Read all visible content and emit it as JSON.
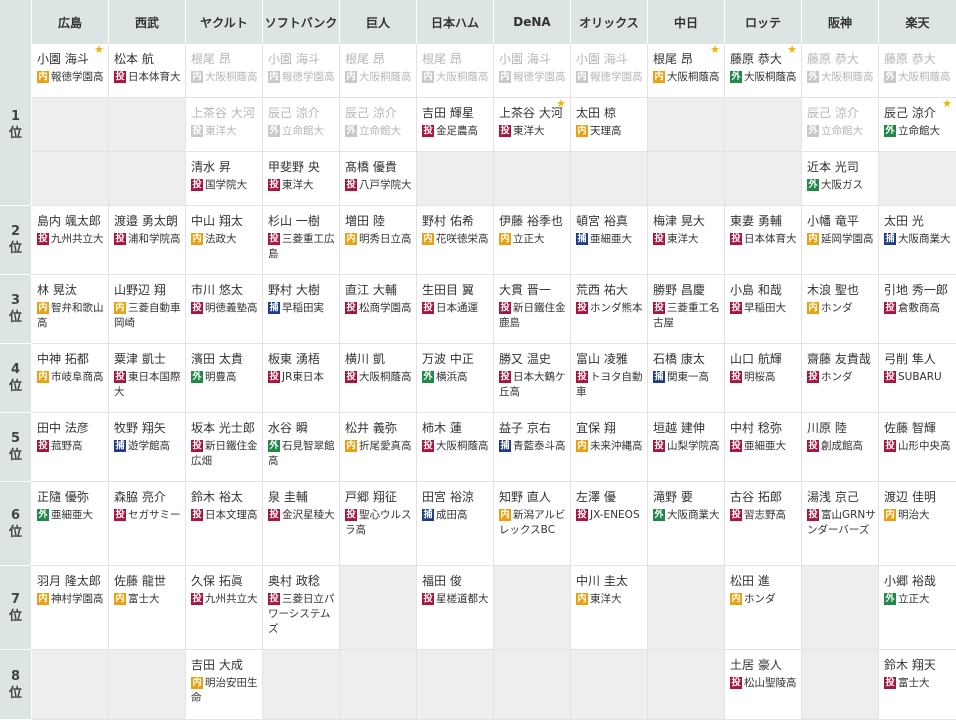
{
  "teams": [
    "広島",
    "西武",
    "ヤクルト",
    "ソフトバンク",
    "巨人",
    "日本ハム",
    "DeNA",
    "オリックス",
    "中日",
    "ロッテ",
    "阪神",
    "楽天"
  ],
  "colors": {
    "header_bg": "#dde4e4",
    "empty_cell_bg": "#eeeeee",
    "star": "#f2b300",
    "grayed_text": "#b6b6b6",
    "grayed_badge": "#c9c9c9",
    "positions": {
      "投": "#a7163f",
      "内": "#e6a214",
      "外": "#22894a",
      "捕": "#1e3c87"
    }
  },
  "rounds": [
    {
      "num": "1",
      "unit": "位",
      "rows": [
        [
          {
            "name": "小園 海斗",
            "pos": "内",
            "school": "報徳学園高",
            "star": true
          },
          {
            "name": "松本 航",
            "pos": "投",
            "school": "日本体育大"
          },
          {
            "name": "根尾 昂",
            "pos": "内",
            "school": "大阪桐蔭高",
            "grayed_out": true
          },
          {
            "name": "小園 海斗",
            "pos": "内",
            "school": "報徳学園高",
            "grayed_out": true
          },
          {
            "name": "根尾 昂",
            "pos": "内",
            "school": "大阪桐蔭高",
            "grayed_out": true
          },
          {
            "name": "根尾 昂",
            "pos": "内",
            "school": "大阪桐蔭高",
            "grayed_out": true
          },
          {
            "name": "小園 海斗",
            "pos": "内",
            "school": "報徳学園高",
            "grayed_out": true
          },
          {
            "name": "小園 海斗",
            "pos": "内",
            "school": "報徳学園高",
            "grayed_out": true
          },
          {
            "name": "根尾 昂",
            "pos": "内",
            "school": "大阪桐蔭高",
            "star": true
          },
          {
            "name": "藤原 恭大",
            "pos": "外",
            "school": "大阪桐蔭高",
            "star": true
          },
          {
            "name": "藤原 恭大",
            "pos": "外",
            "school": "大阪桐蔭高",
            "grayed_out": true
          },
          {
            "name": "藤原 恭大",
            "pos": "外",
            "school": "大阪桐蔭高",
            "grayed_out": true
          }
        ],
        [
          null,
          null,
          {
            "name": "上茶谷 大河",
            "pos": "投",
            "school": "東洋大",
            "grayed_out": true
          },
          {
            "name": "辰己 涼介",
            "pos": "外",
            "school": "立命館大",
            "grayed_out": true
          },
          {
            "name": "辰己 涼介",
            "pos": "外",
            "school": "立命館大",
            "grayed_out": true
          },
          {
            "name": "吉田 輝星",
            "pos": "投",
            "school": "金足農高"
          },
          {
            "name": "上茶谷 大河",
            "pos": "投",
            "school": "東洋大",
            "star": true
          },
          {
            "name": "太田 椋",
            "pos": "内",
            "school": "天理高"
          },
          null,
          null,
          {
            "name": "辰己 涼介",
            "pos": "外",
            "school": "立命館大",
            "grayed_out": true
          },
          {
            "name": "辰己 涼介",
            "pos": "外",
            "school": "立命館大",
            "star": true
          }
        ],
        [
          null,
          null,
          {
            "name": "清水 昇",
            "pos": "投",
            "school": "国学院大"
          },
          {
            "name": "甲斐野 央",
            "pos": "投",
            "school": "東洋大"
          },
          {
            "name": "髙橋 優貴",
            "pos": "投",
            "school": "八戸学院大"
          },
          null,
          null,
          null,
          null,
          null,
          {
            "name": "近本 光司",
            "pos": "外",
            "school": "大阪ガス"
          },
          null
        ]
      ]
    },
    {
      "num": "2",
      "unit": "位",
      "rows": [
        [
          {
            "name": "島内 颯太郎",
            "pos": "投",
            "school": "九州共立大"
          },
          {
            "name": "渡邉 勇太朗",
            "pos": "投",
            "school": "浦和学院高"
          },
          {
            "name": "中山 翔太",
            "pos": "内",
            "school": "法政大"
          },
          {
            "name": "杉山 一樹",
            "pos": "投",
            "school": "三菱重工広島"
          },
          {
            "name": "増田 陸",
            "pos": "内",
            "school": "明秀日立高"
          },
          {
            "name": "野村 佑希",
            "pos": "内",
            "school": "花咲徳栄高"
          },
          {
            "name": "伊藤 裕季也",
            "pos": "内",
            "school": "立正大"
          },
          {
            "name": "頓宮 裕真",
            "pos": "捕",
            "school": "亜細亜大"
          },
          {
            "name": "梅津 晃大",
            "pos": "投",
            "school": "東洋大"
          },
          {
            "name": "東妻 勇輔",
            "pos": "投",
            "school": "日本体育大"
          },
          {
            "name": "小幡 竜平",
            "pos": "内",
            "school": "延岡学園高"
          },
          {
            "name": "太田 光",
            "pos": "捕",
            "school": "大阪商業大"
          }
        ]
      ]
    },
    {
      "num": "3",
      "unit": "位",
      "rows": [
        [
          {
            "name": "林 晃汰",
            "pos": "内",
            "school": "智弁和歌山高"
          },
          {
            "name": "山野辺 翔",
            "pos": "内",
            "school": "三菱自動車岡崎"
          },
          {
            "name": "市川 悠太",
            "pos": "投",
            "school": "明徳義塾高"
          },
          {
            "name": "野村 大樹",
            "pos": "捕",
            "school": "早稲田実"
          },
          {
            "name": "直江 大輔",
            "pos": "投",
            "school": "松商学園高"
          },
          {
            "name": "生田目 翼",
            "pos": "投",
            "school": "日本通運"
          },
          {
            "name": "大貫 晋一",
            "pos": "投",
            "school": "新日鐵住金鹿島"
          },
          {
            "name": "荒西 祐大",
            "pos": "投",
            "school": "ホンダ熊本"
          },
          {
            "name": "勝野 昌慶",
            "pos": "投",
            "school": "三菱重工名古屋"
          },
          {
            "name": "小島 和哉",
            "pos": "投",
            "school": "早稲田大"
          },
          {
            "name": "木浪 聖也",
            "pos": "内",
            "school": "ホンダ"
          },
          {
            "name": "引地 秀一郎",
            "pos": "投",
            "school": "倉敷商高"
          }
        ]
      ]
    },
    {
      "num": "4",
      "unit": "位",
      "rows": [
        [
          {
            "name": "中神 拓都",
            "pos": "内",
            "school": "市岐阜商高"
          },
          {
            "name": "粟津 凱士",
            "pos": "投",
            "school": "東日本国際大"
          },
          {
            "name": "濱田 太貴",
            "pos": "外",
            "school": "明豊高"
          },
          {
            "name": "板東 湧梧",
            "pos": "投",
            "school": "JR東日本"
          },
          {
            "name": "横川 凱",
            "pos": "投",
            "school": "大阪桐蔭高"
          },
          {
            "name": "万波 中正",
            "pos": "外",
            "school": "横浜高"
          },
          {
            "name": "勝又 温史",
            "pos": "投",
            "school": "日本大鶴ケ丘高"
          },
          {
            "name": "富山 凌雅",
            "pos": "投",
            "school": "トヨタ自動車"
          },
          {
            "name": "石橋 康太",
            "pos": "捕",
            "school": "関東一高"
          },
          {
            "name": "山口 航輝",
            "pos": "投",
            "school": "明桜高"
          },
          {
            "name": "齋藤 友貴哉",
            "pos": "投",
            "school": "ホンダ"
          },
          {
            "name": "弓削 隼人",
            "pos": "投",
            "school": "SUBARU"
          }
        ]
      ]
    },
    {
      "num": "5",
      "unit": "位",
      "rows": [
        [
          {
            "name": "田中 法彦",
            "pos": "投",
            "school": "菰野高"
          },
          {
            "name": "牧野 翔矢",
            "pos": "捕",
            "school": "遊学館高"
          },
          {
            "name": "坂本 光士郎",
            "pos": "投",
            "school": "新日鐵住金広畑"
          },
          {
            "name": "水谷 瞬",
            "pos": "外",
            "school": "石見智翠館高"
          },
          {
            "name": "松井 義弥",
            "pos": "内",
            "school": "折尾愛真高"
          },
          {
            "name": "柿木 蓮",
            "pos": "投",
            "school": "大阪桐蔭高"
          },
          {
            "name": "益子 京右",
            "pos": "捕",
            "school": "青藍泰斗高"
          },
          {
            "name": "宜保 翔",
            "pos": "内",
            "school": "未来沖縄高"
          },
          {
            "name": "垣越 建伸",
            "pos": "投",
            "school": "山梨学院高"
          },
          {
            "name": "中村 稔弥",
            "pos": "投",
            "school": "亜細亜大"
          },
          {
            "name": "川原 陸",
            "pos": "投",
            "school": "創成館高"
          },
          {
            "name": "佐藤 智輝",
            "pos": "投",
            "school": "山形中央高"
          }
        ]
      ]
    },
    {
      "num": "6",
      "unit": "位",
      "rows": [
        [
          {
            "name": "正隨 優弥",
            "pos": "外",
            "school": "亜細亜大"
          },
          {
            "name": "森脇 亮介",
            "pos": "投",
            "school": "セガサミー"
          },
          {
            "name": "鈴木 裕太",
            "pos": "投",
            "school": "日本文理高"
          },
          {
            "name": "泉 圭輔",
            "pos": "投",
            "school": "金沢星稜大"
          },
          {
            "name": "戸郷 翔征",
            "pos": "投",
            "school": "聖心ウルスラ高"
          },
          {
            "name": "田宮 裕涼",
            "pos": "捕",
            "school": "成田高"
          },
          {
            "name": "知野 直人",
            "pos": "内",
            "school": "新潟アルビレックスBC"
          },
          {
            "name": "左澤 優",
            "pos": "投",
            "school": "JX-ENEOS"
          },
          {
            "name": "滝野 要",
            "pos": "外",
            "school": "大阪商業大"
          },
          {
            "name": "古谷 拓郎",
            "pos": "投",
            "school": "習志野高"
          },
          {
            "name": "湯浅 京己",
            "pos": "投",
            "school": "富山GRNサンダーバーズ"
          },
          {
            "name": "渡辺 佳明",
            "pos": "内",
            "school": "明治大"
          }
        ]
      ]
    },
    {
      "num": "7",
      "unit": "位",
      "rows": [
        [
          {
            "name": "羽月 隆太郎",
            "pos": "内",
            "school": "神村学園高"
          },
          {
            "name": "佐藤 龍世",
            "pos": "内",
            "school": "富士大"
          },
          {
            "name": "久保 拓眞",
            "pos": "投",
            "school": "九州共立大"
          },
          {
            "name": "奥村 政稔",
            "pos": "投",
            "school": "三菱日立パワーシステムズ"
          },
          null,
          {
            "name": "福田 俊",
            "pos": "投",
            "school": "星槎道都大"
          },
          null,
          {
            "name": "中川 圭太",
            "pos": "内",
            "school": "東洋大"
          },
          null,
          {
            "name": "松田 進",
            "pos": "内",
            "school": "ホンダ"
          },
          null,
          {
            "name": "小郷 裕哉",
            "pos": "外",
            "school": "立正大"
          }
        ]
      ]
    },
    {
      "num": "8",
      "unit": "位",
      "rows": [
        [
          null,
          null,
          {
            "name": "吉田 大成",
            "pos": "内",
            "school": "明治安田生命"
          },
          null,
          null,
          null,
          null,
          null,
          null,
          {
            "name": "土居 豪人",
            "pos": "投",
            "school": "松山聖陵高"
          },
          null,
          {
            "name": "鈴木 翔天",
            "pos": "投",
            "school": "富士大"
          }
        ]
      ]
    }
  ]
}
